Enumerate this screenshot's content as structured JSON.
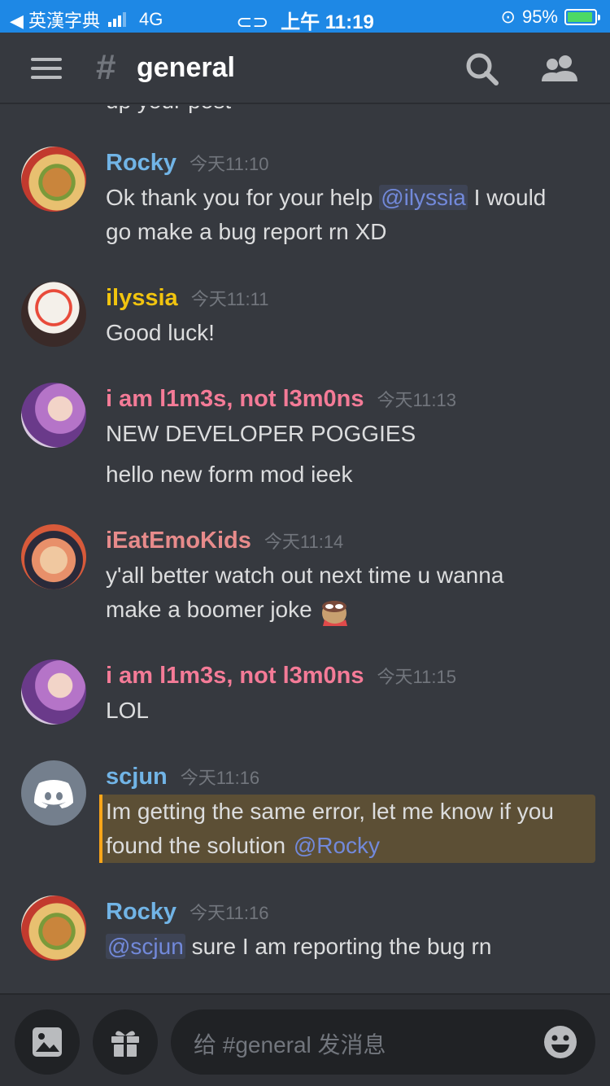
{
  "status_bar": {
    "back_app": "◀ 英漢字典",
    "network": "4G",
    "time": "上午 11:19",
    "battery": "95%"
  },
  "header": {
    "hash": "#",
    "channel": "general"
  },
  "cutoff_text": "up your post",
  "messages": [
    {
      "author": "Rocky",
      "color": "#71b4e6",
      "time": "今天11:10",
      "lines": [
        {
          "pre": "Ok thank you for your help ",
          "mention": "@ilyssia",
          "post": "  I would"
        },
        {
          "pre": "go make a bug report rn XD"
        }
      ]
    },
    {
      "author": "ilyssia",
      "color": "#f1c40f",
      "time": "今天11:11",
      "lines": [
        {
          "pre": "Good luck!"
        }
      ]
    },
    {
      "author": "i am l1m3s, not l3m0ns",
      "color": "#f47b97",
      "time": "今天11:13",
      "lines": [
        {
          "pre": "NEW DEVELOPER POGGIES"
        },
        {
          "pre": "hello new form mod ieek"
        }
      ]
    },
    {
      "author": "iEatEmoKids",
      "color": "#e78b8b",
      "time": "今天11:14",
      "lines": [
        {
          "pre": "y'all better watch out next time u wanna"
        },
        {
          "pre": "make a boomer joke "
        }
      ]
    },
    {
      "author": "i am l1m3s, not l3m0ns",
      "color": "#f47b97",
      "time": "今天11:15",
      "lines": [
        {
          "pre": "LOL"
        }
      ]
    },
    {
      "author": "scjun",
      "color": "#71b4e6",
      "time": "今天11:16",
      "lines": [
        {
          "pre": "Im getting the same error, let me know if you"
        },
        {
          "pre": "found the solution ",
          "mention": "@Rocky"
        }
      ]
    },
    {
      "author": "Rocky",
      "color": "#71b4e6",
      "time": "今天11:16",
      "lines": [
        {
          "mention": "@scjun",
          "post": " sure I am reporting the bug rn"
        }
      ]
    }
  ],
  "input": {
    "placeholder": "给 #general 发消息"
  },
  "icons": {
    "menu": "hamburger-icon",
    "search": "search-icon",
    "members": "members-icon",
    "image": "image-icon",
    "gift": "gift-icon",
    "emoji": "emoji-icon"
  }
}
